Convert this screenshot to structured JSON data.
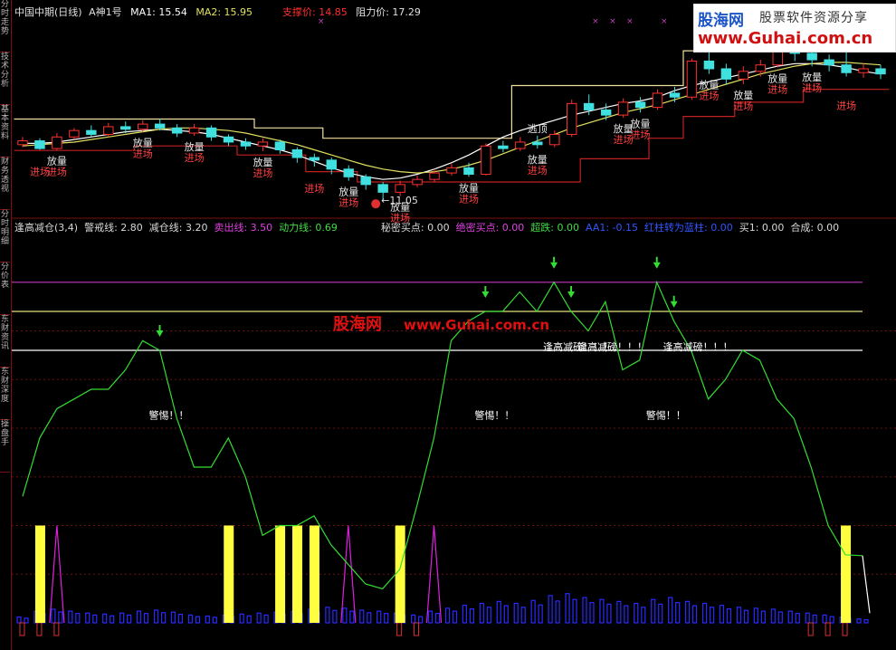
{
  "sidebar": {
    "tabs": [
      "分时走势",
      "技术分析",
      "基本资料",
      "财务透视",
      "分时明细",
      "分价表",
      "东财资讯",
      "东财深度",
      "操盘手"
    ]
  },
  "top_header": {
    "name": "中国中期(日线)",
    "indicator": "A神1号",
    "ma1_label": "MA1: 15.54",
    "ma2_label": "MA2: 15.95",
    "support_label": "支撑价: 14.85",
    "resist_label": "阻力价: 17.29"
  },
  "bottom_header": {
    "items": [
      {
        "text": "逢高减仓(3,4)",
        "color": "#d8d8d8"
      },
      {
        "text": "警戒线: 2.80",
        "color": "#d8d8d8"
      },
      {
        "text": "减仓线: 3.20",
        "color": "#d8d8d8"
      },
      {
        "text": "卖出线: 3.50",
        "color": "#e040e0"
      },
      {
        "text": "动力线: 0.69",
        "color": "#44dd44"
      },
      {
        "text": "秘密买点: 0.00",
        "color": "#d8d8d8"
      },
      {
        "text": "绝密买点: 0.00",
        "color": "#e040e0"
      },
      {
        "text": "超跌: 0.00",
        "color": "#44dd44"
      },
      {
        "text": "AA1: -0.15",
        "color": "#3355ff"
      },
      {
        "text": "红柱转为蓝柱: 0.00",
        "color": "#3355ff"
      },
      {
        "text": "买1: 0.00",
        "color": "#d8d8d8"
      },
      {
        "text": "合成: 0.00",
        "color": "#d8d8d8"
      }
    ]
  },
  "logo": {
    "name": "股海网",
    "slogan": "股票软件资源分享",
    "url": "www.Guhai.com.cn"
  },
  "watermark": {
    "name": "股海网",
    "url": "www.Guhai.com.cn"
  },
  "colors": {
    "up": "#ff3030",
    "down": "#40e0e0",
    "ma1": "#ffffff",
    "ma2": "#e0e060",
    "resist": "#f0e0a0",
    "support": "#c02020",
    "motion": "#33dd33",
    "sell_line": "#c040c0",
    "yellow_bar": "#ffff40",
    "blue_bar": "#2a2aff",
    "magenta": "#e020e0"
  },
  "chart_data": [
    {
      "type": "candlestick",
      "title": "中国中期(日线)",
      "lowest_label": "11.05",
      "series": [
        {
          "name": "MA1",
          "values": [
            15.4,
            15.4,
            15.5,
            15.7,
            15.9,
            16.1,
            16.3,
            16.4,
            16.5,
            16.4,
            16.3,
            16.1,
            15.8,
            15.5,
            15.2,
            14.9,
            14.5,
            14.0,
            13.5,
            13.1,
            12.8,
            12.6,
            12.7,
            13.0,
            13.4,
            13.9,
            14.5,
            15.2,
            15.9,
            16.4,
            16.8,
            17.2,
            17.6,
            17.9,
            18.2,
            18.5,
            18.7,
            19.0,
            19.5,
            19.9,
            20.2,
            20.5,
            20.8,
            21.1,
            21.4,
            21.6,
            21.6,
            21.5,
            21.3,
            21.0,
            20.8
          ]
        },
        {
          "name": "MA2",
          "values": [
            15.2,
            15.3,
            15.4,
            15.5,
            15.7,
            15.9,
            16.1,
            16.3,
            16.5,
            16.6,
            16.6,
            16.5,
            16.4,
            16.2,
            15.9,
            15.6,
            15.3,
            14.9,
            14.5,
            14.1,
            13.7,
            13.4,
            13.2,
            13.1,
            13.2,
            13.4,
            13.7,
            14.1,
            14.6,
            15.1,
            15.6,
            16.1,
            16.6,
            17.0,
            17.4,
            17.8,
            18.1,
            18.4,
            18.8,
            19.2,
            19.6,
            20.0,
            20.4,
            20.8,
            21.1,
            21.4,
            21.6,
            21.7,
            21.7,
            21.6,
            21.5
          ]
        }
      ],
      "support": [
        14.85,
        14.85,
        14.85,
        14.85,
        14.85,
        14.85,
        14.85,
        15.2,
        15.2,
        15.2,
        15.2,
        15.2,
        15.2,
        14.5,
        14.5,
        14.5,
        14.5,
        13.2,
        13.2,
        13.2,
        12.4,
        12.4,
        12.4,
        12.4,
        12.4,
        12.4,
        12.4,
        12.4,
        12.4,
        12.4,
        12.4,
        12.4,
        12.4,
        14.2,
        14.2,
        14.2,
        14.2,
        15.8,
        15.8,
        17.5,
        17.5,
        17.5,
        18.6,
        18.6,
        18.6,
        18.6,
        19.6,
        19.6,
        19.6,
        19.6,
        19.6
      ],
      "resist": [
        17.29,
        17.29,
        17.29,
        17.29,
        17.29,
        17.29,
        17.29,
        17.29,
        17.29,
        17.29,
        17.29,
        17.29,
        17.29,
        17.29,
        16.6,
        16.6,
        16.6,
        16.6,
        15.8,
        15.8,
        15.8,
        15.8,
        15.8,
        15.8,
        15.8,
        15.8,
        15.8,
        15.8,
        15.8,
        19.9,
        19.9,
        19.9,
        19.9,
        19.9,
        19.9,
        19.9,
        19.9,
        19.9,
        19.9,
        22.6,
        22.6,
        22.6,
        23.4,
        23.4,
        23.4,
        23.4,
        23.4,
        23.4,
        23.4,
        23.4,
        23.4
      ],
      "ylim": [
        10.5,
        25
      ],
      "labels": [
        {
          "idx": 1,
          "text": "进场",
          "color": "#ff4040",
          "pos": "below",
          "dy": 18
        },
        {
          "idx": 2,
          "text": "放量",
          "color": "#e8e8e8",
          "pos": "below",
          "dy": 6
        },
        {
          "idx": 2,
          "text": "进场",
          "color": "#ff4040",
          "pos": "below",
          "dy": 18
        },
        {
          "idx": 7,
          "text": "放量",
          "color": "#e8e8e8",
          "pos": "below",
          "dy": 6
        },
        {
          "idx": 7,
          "text": "进场",
          "color": "#ff4040",
          "pos": "below",
          "dy": 18
        },
        {
          "idx": 10,
          "text": "放量",
          "color": "#e8e8e8",
          "pos": "below",
          "dy": 6
        },
        {
          "idx": 10,
          "text": "进场",
          "color": "#ff4040",
          "pos": "below",
          "dy": 18
        },
        {
          "idx": 14,
          "text": "放量",
          "color": "#e8e8e8",
          "pos": "below",
          "dy": 6
        },
        {
          "idx": 14,
          "text": "进场",
          "color": "#ff4040",
          "pos": "below",
          "dy": 18
        },
        {
          "idx": 17,
          "text": "进场",
          "color": "#ff4040",
          "pos": "below",
          "dy": 18
        },
        {
          "idx": 19,
          "text": "放量",
          "color": "#e8e8e8",
          "pos": "below",
          "dy": 6
        },
        {
          "idx": 19,
          "text": "进场",
          "color": "#ff4040",
          "pos": "below",
          "dy": 18
        },
        {
          "idx": 22,
          "text": "放量",
          "color": "#e8e8e8",
          "pos": "below",
          "dy": 6
        },
        {
          "idx": 22,
          "text": "进场",
          "color": "#ff4040",
          "pos": "below",
          "dy": 18
        },
        {
          "idx": 26,
          "text": "放量",
          "color": "#e8e8e8",
          "pos": "below",
          "dy": 6
        },
        {
          "idx": 26,
          "text": "进场",
          "color": "#ff4040",
          "pos": "below",
          "dy": 18
        },
        {
          "idx": 30,
          "text": "逃顶",
          "color": "#e8e8e8",
          "pos": "above",
          "dy": -4
        },
        {
          "idx": 30,
          "text": "放量",
          "color": "#e8e8e8",
          "pos": "below",
          "dy": 6
        },
        {
          "idx": 30,
          "text": "进场",
          "color": "#ff4040",
          "pos": "below",
          "dy": 18
        },
        {
          "idx": 35,
          "text": "放量",
          "color": "#e8e8e8",
          "pos": "below",
          "dy": 6
        },
        {
          "idx": 35,
          "text": "进场",
          "color": "#ff4040",
          "pos": "below",
          "dy": 18
        },
        {
          "idx": 36,
          "text": "放量",
          "color": "#e8e8e8",
          "pos": "below",
          "dy": 6
        },
        {
          "idx": 36,
          "text": "进场",
          "color": "#ff4040",
          "pos": "below",
          "dy": 18
        },
        {
          "idx": 40,
          "text": "放量",
          "color": "#e8e8e8",
          "pos": "below",
          "dy": 6
        },
        {
          "idx": 40,
          "text": "进场",
          "color": "#ff4040",
          "pos": "below",
          "dy": 18
        },
        {
          "idx": 42,
          "text": "放量",
          "color": "#e8e8e8",
          "pos": "below",
          "dy": 6
        },
        {
          "idx": 42,
          "text": "进场",
          "color": "#ff4040",
          "pos": "below",
          "dy": 18
        },
        {
          "idx": 44,
          "text": "放量",
          "color": "#e8e8e8",
          "pos": "below",
          "dy": 6
        },
        {
          "idx": 44,
          "text": "进场",
          "color": "#ff4040",
          "pos": "below",
          "dy": 18
        },
        {
          "idx": 46,
          "text": "放量",
          "color": "#e8e8e8",
          "pos": "below",
          "dy": 6
        },
        {
          "idx": 46,
          "text": "进场",
          "color": "#ff4040",
          "pos": "below",
          "dy": 18
        },
        {
          "idx": 48,
          "text": "进场",
          "color": "#ff4040",
          "pos": "below",
          "dy": 26
        }
      ],
      "candles": [
        [
          15.3,
          15.6,
          15.9,
          15.1
        ],
        [
          15.6,
          15.0,
          15.8,
          14.9
        ],
        [
          15.0,
          15.9,
          16.2,
          14.9
        ],
        [
          15.9,
          16.4,
          16.6,
          15.7
        ],
        [
          16.4,
          16.1,
          16.8,
          15.9
        ],
        [
          16.1,
          16.7,
          17.0,
          15.9
        ],
        [
          16.7,
          16.5,
          17.1,
          16.2
        ],
        [
          16.5,
          16.9,
          17.2,
          16.3
        ],
        [
          16.9,
          16.6,
          17.3,
          16.4
        ],
        [
          16.6,
          16.2,
          16.9,
          15.9
        ],
        [
          16.2,
          16.6,
          16.9,
          16.0
        ],
        [
          16.6,
          15.9,
          16.8,
          15.6
        ],
        [
          15.9,
          15.5,
          16.1,
          15.2
        ],
        [
          15.5,
          15.2,
          15.8,
          14.9
        ],
        [
          15.2,
          15.5,
          15.8,
          14.8
        ],
        [
          15.5,
          14.9,
          15.7,
          14.6
        ],
        [
          14.9,
          14.3,
          15.1,
          13.9
        ],
        [
          14.3,
          14.1,
          14.6,
          13.6
        ],
        [
          14.1,
          13.4,
          14.3,
          13.0
        ],
        [
          13.4,
          12.8,
          13.7,
          12.5
        ],
        [
          12.8,
          12.2,
          13.0,
          11.8
        ],
        [
          12.2,
          11.6,
          12.4,
          11.05
        ],
        [
          11.6,
          12.2,
          12.5,
          11.3
        ],
        [
          12.2,
          12.6,
          12.9,
          12.0
        ],
        [
          12.6,
          13.1,
          13.4,
          12.4
        ],
        [
          13.1,
          13.5,
          13.8,
          12.9
        ],
        [
          13.5,
          13.0,
          13.9,
          12.8
        ],
        [
          13.0,
          15.2,
          15.4,
          12.9
        ],
        [
          15.2,
          15.0,
          15.6,
          14.7
        ],
        [
          15.0,
          15.5,
          15.9,
          14.8
        ],
        [
          15.5,
          15.3,
          16.0,
          15.0
        ],
        [
          15.3,
          16.1,
          16.4,
          15.1
        ],
        [
          16.1,
          18.5,
          18.8,
          15.9
        ],
        [
          18.5,
          18.0,
          19.2,
          17.6
        ],
        [
          18.0,
          17.6,
          18.5,
          17.2
        ],
        [
          17.6,
          18.6,
          18.9,
          17.4
        ],
        [
          18.6,
          18.2,
          19.0,
          17.8
        ],
        [
          18.2,
          19.3,
          19.6,
          18.0
        ],
        [
          19.3,
          19.0,
          19.8,
          18.6
        ],
        [
          19.0,
          21.8,
          22.0,
          18.8
        ],
        [
          21.8,
          21.2,
          22.5,
          20.8
        ],
        [
          21.2,
          20.4,
          21.6,
          20.0
        ],
        [
          20.4,
          21.0,
          21.4,
          20.0
        ],
        [
          21.0,
          21.5,
          21.9,
          20.6
        ],
        [
          21.5,
          22.7,
          23.4,
          21.3
        ],
        [
          22.7,
          22.4,
          24.0,
          21.8
        ],
        [
          22.4,
          21.9,
          22.8,
          21.4
        ],
        [
          21.9,
          21.5,
          22.3,
          21.0
        ],
        [
          21.5,
          20.9,
          22.6,
          20.6
        ],
        [
          20.9,
          21.2,
          21.6,
          20.5
        ],
        [
          21.2,
          20.8,
          21.5,
          20.4
        ]
      ]
    },
    {
      "type": "line",
      "title": "逢高减仓(3,4)",
      "ylim": [
        0,
        4
      ],
      "hlines": [
        {
          "name": "卖出线",
          "value": 3.5,
          "color": "#b030b0"
        },
        {
          "name": "减仓线",
          "value": 3.2,
          "color": "#e8e080"
        },
        {
          "name": "警戒线",
          "value": 2.8,
          "color": "#ffffff"
        }
      ],
      "series": [
        {
          "name": "动力线",
          "values": [
            1.3,
            1.9,
            2.2,
            2.3,
            2.4,
            2.4,
            2.6,
            2.9,
            2.8,
            2.1,
            1.6,
            1.6,
            1.9,
            1.5,
            0.9,
            1.0,
            1.0,
            1.1,
            0.8,
            0.6,
            0.4,
            0.35,
            0.55,
            1.2,
            1.9,
            2.9,
            3.1,
            3.2,
            3.2,
            3.4,
            3.2,
            3.5,
            3.2,
            3.0,
            3.3,
            2.6,
            2.7,
            3.5,
            3.1,
            2.8,
            2.3,
            2.5,
            2.8,
            2.7,
            2.3,
            2.1,
            1.6,
            1.0,
            0.7,
            0.69
          ]
        }
      ],
      "annotations": [
        {
          "idx": 8,
          "text": "警惕！！",
          "type": "text",
          "value": 2.1
        },
        {
          "idx": 27,
          "text": "警惕！！",
          "type": "text",
          "value": 2.1
        },
        {
          "idx": 37,
          "text": "警惕！！",
          "type": "text",
          "value": 2.1
        },
        {
          "idx": 31,
          "text": "逢高减磅！！！",
          "type": "text",
          "value": 2.8
        },
        {
          "idx": 33,
          "text": "逢高减磅！！！",
          "type": "text",
          "value": 2.8
        },
        {
          "idx": 38,
          "text": "逢高减磅！！！",
          "type": "text",
          "value": 2.8
        }
      ],
      "arrows": [
        8,
        27,
        31,
        32,
        37,
        38
      ],
      "yellow_bars": [
        1,
        12,
        15,
        16,
        17,
        22,
        48
      ],
      "magenta_peaks": [
        2,
        19,
        24
      ],
      "blue_bars": [
        0.06,
        0.12,
        0.14,
        0.12,
        0.1,
        0.09,
        0.1,
        0.12,
        0.13,
        0.11,
        0.08,
        0.07,
        0.08,
        0.09,
        0.1,
        0.11,
        0.12,
        0.14,
        0.16,
        0.15,
        0.13,
        0.12,
        0.1,
        0.08,
        0.12,
        0.15,
        0.18,
        0.2,
        0.22,
        0.2,
        0.23,
        0.28,
        0.3,
        0.26,
        0.24,
        0.22,
        0.2,
        0.24,
        0.26,
        0.22,
        0.2,
        0.18,
        0.16,
        0.15,
        0.14,
        0.12,
        0.1,
        0.08,
        0.06,
        0.04
      ]
    }
  ]
}
